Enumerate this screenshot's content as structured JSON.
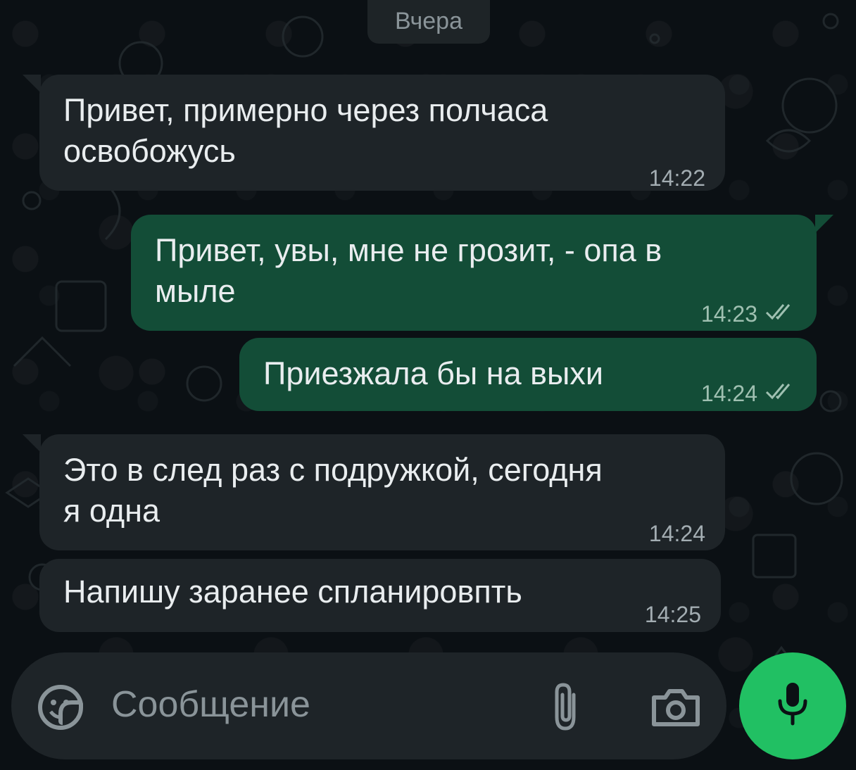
{
  "date_separator": "Вчера",
  "messages": [
    {
      "direction": "incoming",
      "text": "Привет, примерно через полчаса\nосвобожусь",
      "time": "14:22"
    },
    {
      "direction": "outgoing",
      "text": "Привет, увы, мне не грозит, - опа в\nмыле",
      "time": "14:23",
      "status": "read"
    },
    {
      "direction": "outgoing",
      "text": "Приезжала бы на выхи",
      "time": "14:24",
      "status": "read"
    },
    {
      "direction": "incoming",
      "text": "Это в след раз с подружкой, сегодня\nя одна",
      "time": "14:24"
    },
    {
      "direction": "incoming",
      "text": "Напишу заранее спланировпть",
      "time": "14:25"
    }
  ],
  "composer": {
    "placeholder": "Сообщение",
    "icons": [
      "emoji-sticker-icon",
      "paperclip-icon",
      "camera-icon",
      "microphone-icon"
    ]
  },
  "colors": {
    "background": "#0b1014",
    "incoming_bubble": "#1e2428",
    "outgoing_bubble": "#134d37",
    "accent": "#21c063",
    "read_ticks": "#9fc0b1"
  }
}
